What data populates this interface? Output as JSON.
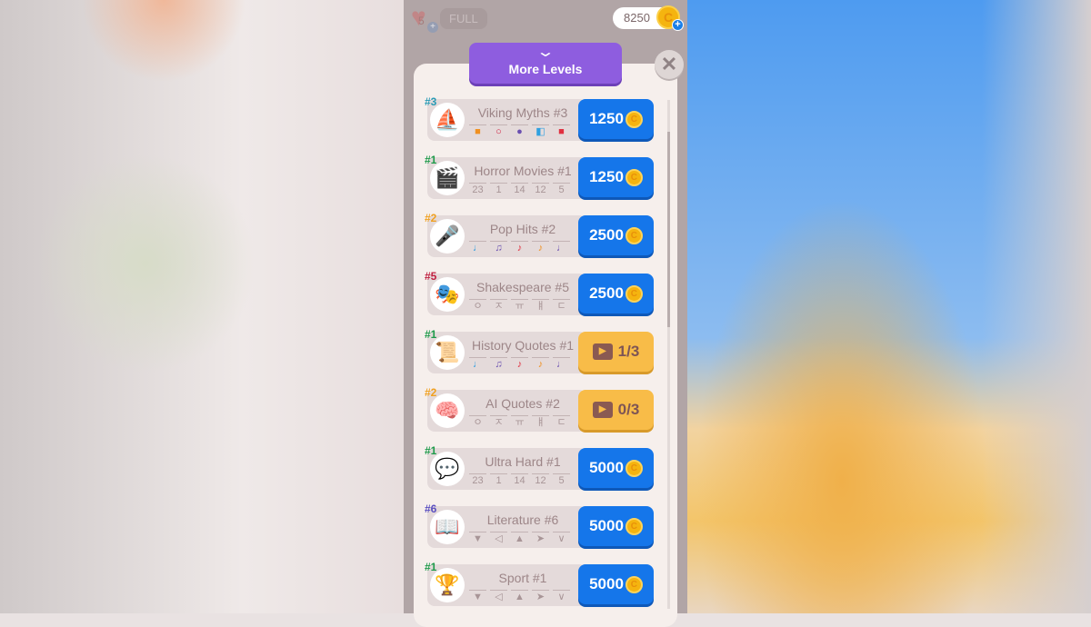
{
  "header": {
    "lives": "5",
    "lives_status": "FULL",
    "coins": "8250"
  },
  "more_levels": {
    "label": "More Levels"
  },
  "colors": {
    "blue_button": "#1576ea",
    "yellow_button": "#f8bc48",
    "purple_header": "#8e5ddf"
  },
  "levels": [
    {
      "tag": "#3",
      "tag_color": "#2a9bb5",
      "icon": "viking-ship-icon",
      "glyph": "⛵",
      "title": "Viking Myths #3",
      "symbols": [
        "■",
        "○",
        "●",
        "◧",
        "■"
      ],
      "symbol_colors": [
        "#f09020",
        "#d02040",
        "#6a4fb0",
        "#30a0e0",
        "#e03040"
      ],
      "button": {
        "type": "price",
        "value": "1250"
      }
    },
    {
      "tag": "#1",
      "tag_color": "#1e9a4a",
      "icon": "clapperboard-icon",
      "glyph": "🎬",
      "title": "Horror Movies #1",
      "symbols": [
        "23",
        "1",
        "14",
        "12",
        "5"
      ],
      "button": {
        "type": "price",
        "value": "1250"
      }
    },
    {
      "tag": "#2",
      "tag_color": "#f0a020",
      "icon": "microphone-icon",
      "glyph": "🎤",
      "title": "Pop Hits #2",
      "symbols": [
        "♩",
        "♫",
        "♪",
        "♪",
        "♩"
      ],
      "symbol_colors": [
        "#2a9be0",
        "#6a4fb0",
        "#e03040",
        "#f09020",
        "#6a4fb0"
      ],
      "button": {
        "type": "price",
        "value": "2500"
      }
    },
    {
      "tag": "#5",
      "tag_color": "#c02040",
      "icon": "theater-masks-icon",
      "glyph": "🎭",
      "title": "Shakespeare #5",
      "symbols": [
        "ㅇ",
        "ㅈ",
        "ㅠ",
        "ㅒ",
        "ㄷ"
      ],
      "button": {
        "type": "price",
        "value": "2500"
      }
    },
    {
      "tag": "#1",
      "tag_color": "#1e9a4a",
      "icon": "quill-scroll-icon",
      "glyph": "📜",
      "title": "History Quotes #1",
      "symbols": [
        "♩",
        "♫",
        "♪",
        "♪",
        "♩"
      ],
      "symbol_colors": [
        "#2a9be0",
        "#6a4fb0",
        "#e03040",
        "#f09020",
        "#6a4fb0"
      ],
      "button": {
        "type": "video",
        "value": "1/3"
      }
    },
    {
      "tag": "#2",
      "tag_color": "#f0a020",
      "icon": "circuit-brain-icon",
      "glyph": "🧠",
      "title": "AI Quotes #2",
      "symbols": [
        "ㅇ",
        "ㅈ",
        "ㅠ",
        "ㅒ",
        "ㄷ"
      ],
      "button": {
        "type": "video",
        "value": "0/3"
      }
    },
    {
      "tag": "#1",
      "tag_color": "#1e9a4a",
      "icon": "quote-brain-icon",
      "glyph": "💬",
      "title": "Ultra Hard #1",
      "symbols": [
        "23",
        "1",
        "14",
        "12",
        "5"
      ],
      "button": {
        "type": "price",
        "value": "5000"
      }
    },
    {
      "tag": "#6",
      "tag_color": "#5a4fc0",
      "icon": "book-quill-icon",
      "glyph": "📖",
      "title": "Literature #6",
      "symbols": [
        "▼",
        "◁",
        "▲",
        "➤",
        "∨"
      ],
      "button": {
        "type": "price",
        "value": "5000"
      }
    },
    {
      "tag": "#1",
      "tag_color": "#1e9a4a",
      "icon": "trophy-icon",
      "glyph": "🏆",
      "title": "Sport #1",
      "symbols": [
        "▼",
        "◁",
        "▲",
        "➤",
        "∨"
      ],
      "button": {
        "type": "price",
        "value": "5000"
      }
    }
  ]
}
